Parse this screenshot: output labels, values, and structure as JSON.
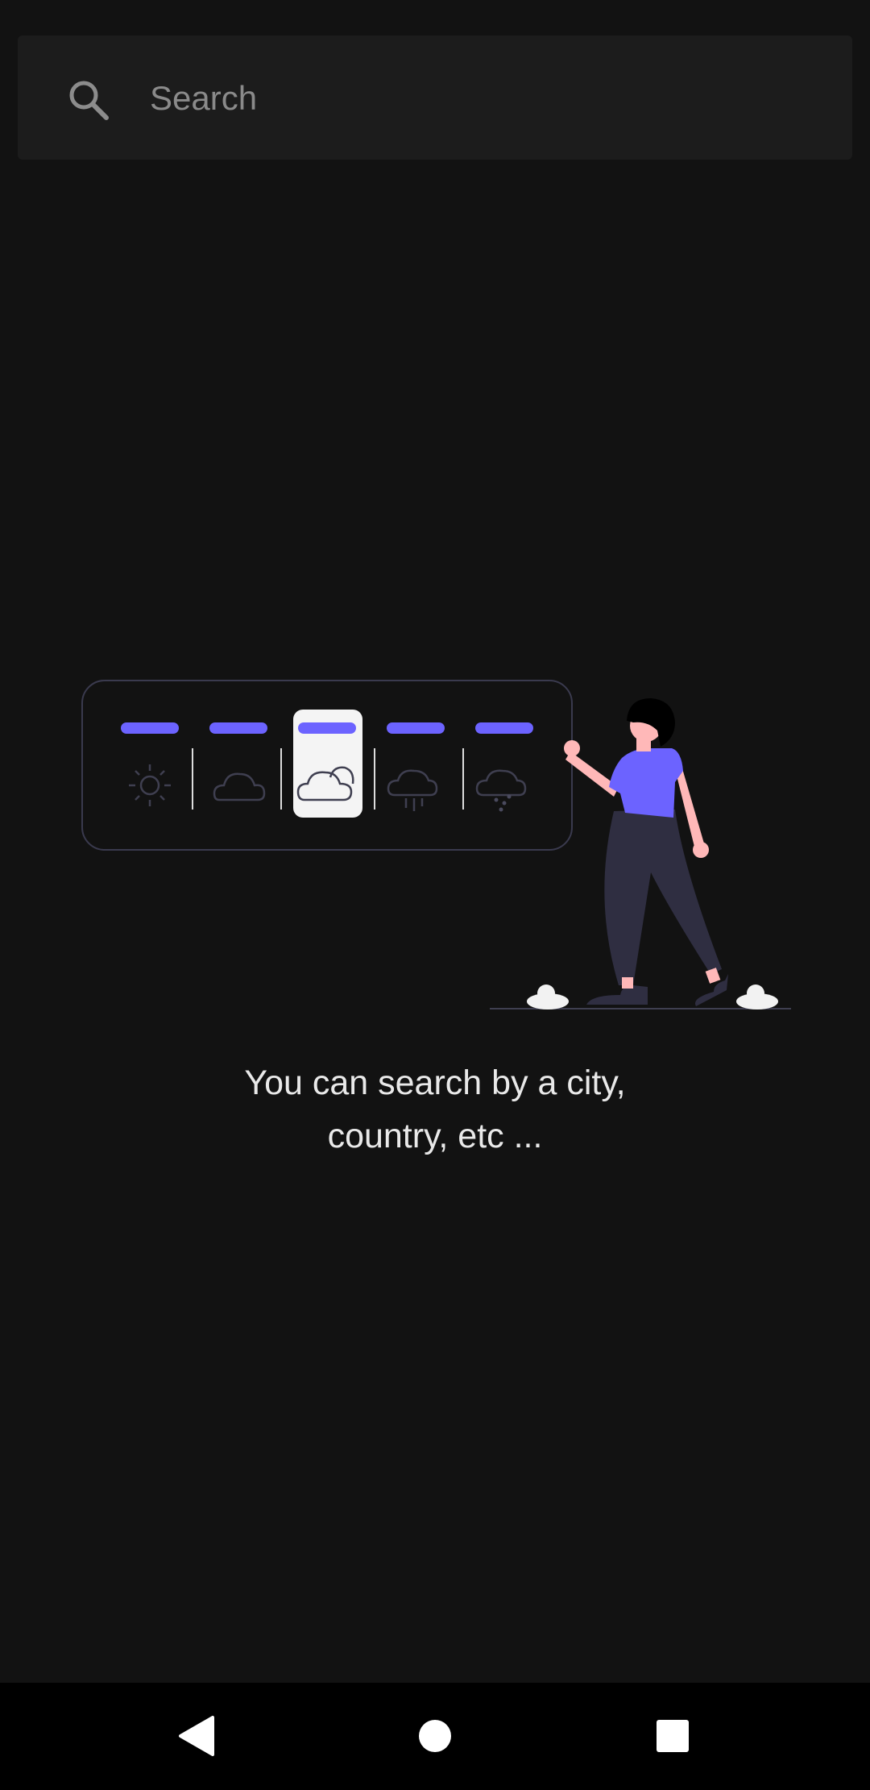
{
  "search": {
    "placeholder": "Search",
    "value": ""
  },
  "empty_state": {
    "line1": "You can search by a city,",
    "line2": "country, etc ..."
  },
  "navigation": {
    "back": "back-icon",
    "home": "home-icon",
    "recents": "recents-icon"
  },
  "colors": {
    "background": "#121212",
    "search_bar": "#1c1c1c",
    "accent": "#6c63ff",
    "nav_bar": "#000000"
  }
}
